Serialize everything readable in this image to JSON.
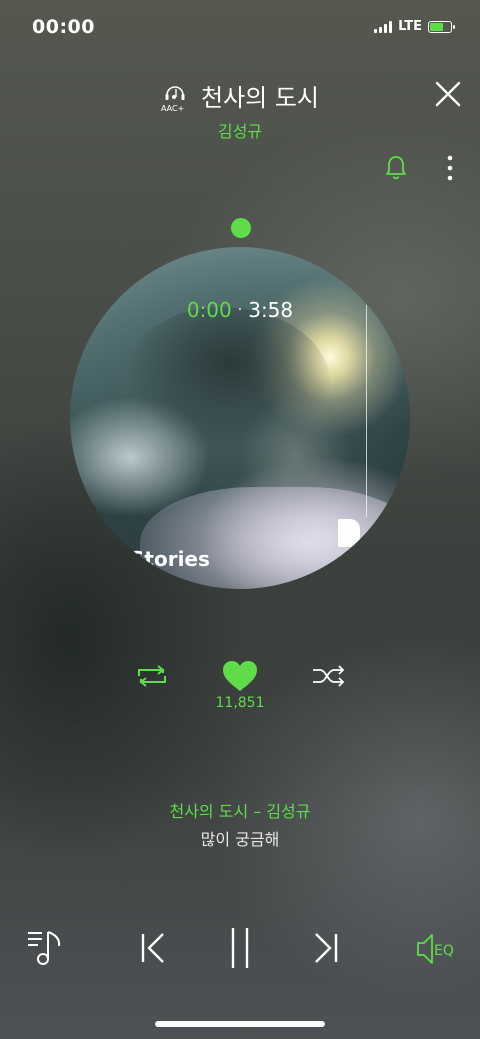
{
  "status_bar": {
    "time": "00:00",
    "network": "LTE",
    "battery_charging": true
  },
  "header": {
    "quality_badge": "AAC+",
    "quality_icon": "headphone-music-icon",
    "title": "천사의 도시",
    "artist": "김성규"
  },
  "header_actions": {
    "close_icon": "close-icon",
    "bell_icon": "bell-icon",
    "more_icon": "more-vertical-icon"
  },
  "album_art": {
    "overlay_text": "Stories"
  },
  "playback": {
    "current_time": "0:00",
    "separator": "·",
    "total_time": "3:58",
    "progress_fraction": 0.0
  },
  "actions": {
    "repeat_icon": "repeat-icon",
    "like_icon": "heart-icon",
    "like_count": "11,851",
    "shuffle_icon": "shuffle-icon"
  },
  "lyrics": {
    "current": "천사의 도시 – 김성규",
    "next": "많이 궁금해"
  },
  "controls": {
    "playlist_icon": "playlist-icon",
    "prev_icon": "skip-previous-icon",
    "pause_icon": "pause-icon",
    "next_icon": "skip-next-icon",
    "eq_label": "EQ"
  },
  "colors": {
    "accent": "#5fdc4a",
    "text": "#ffffff"
  }
}
